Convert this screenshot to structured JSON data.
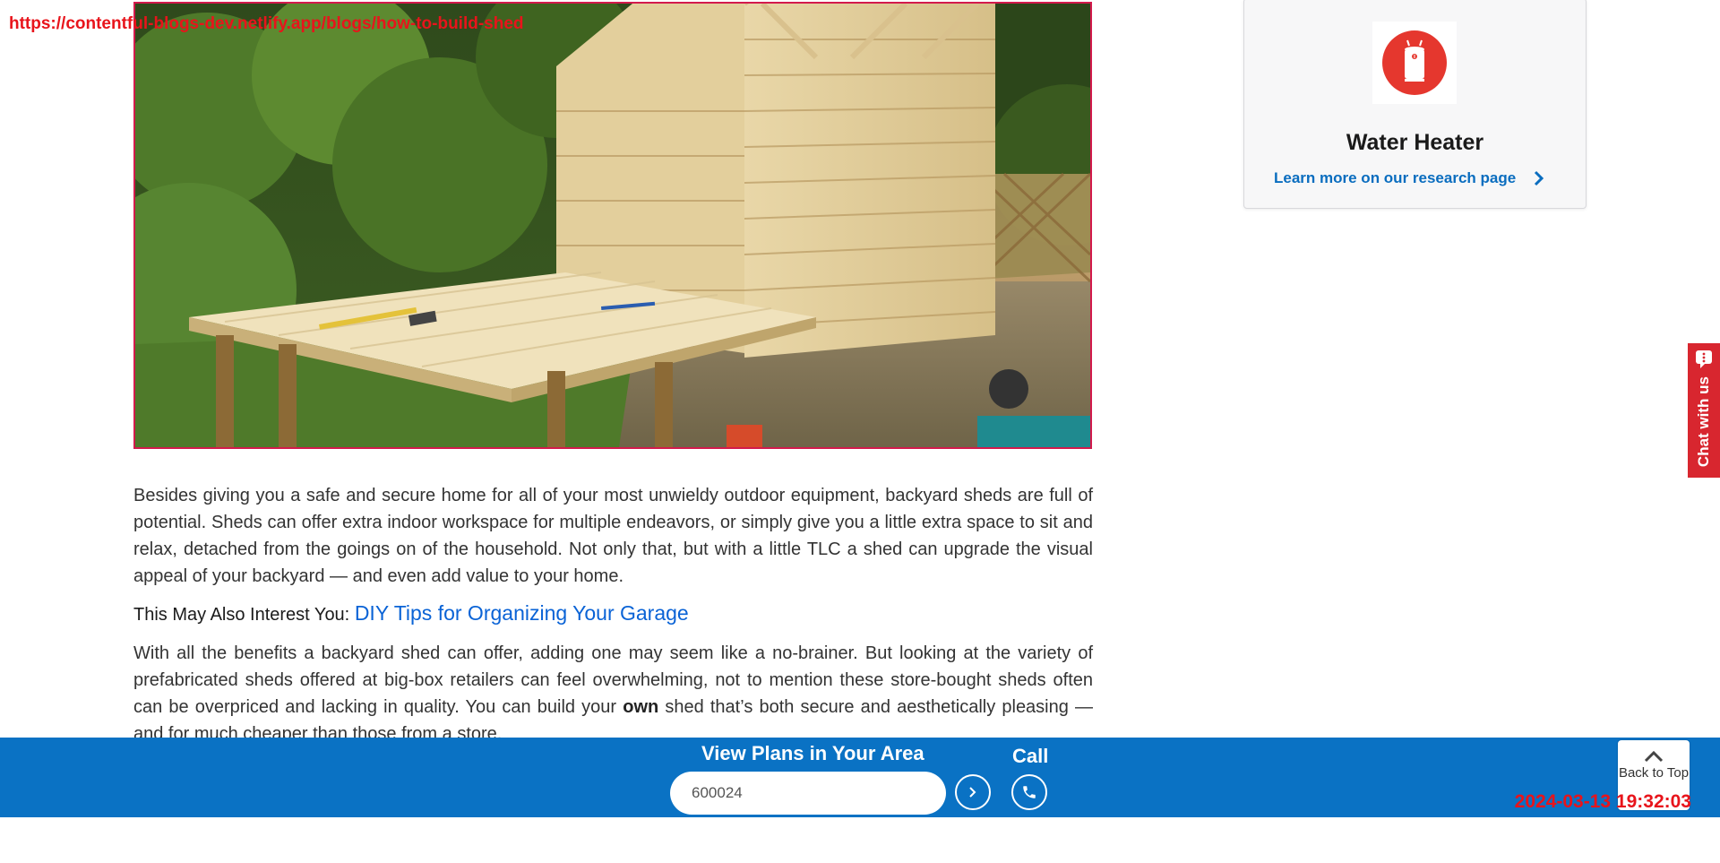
{
  "overlay": {
    "url": "https://contentful-blogs-dev.netlify.app/blogs/how-to-build-shed",
    "timestamp": "2024-03-13 19:32:03"
  },
  "article": {
    "paragraph1": "Besides giving you a safe and secure home for all of your most unwieldy outdoor equipment, backyard sheds are full of potential. Sheds can offer extra indoor workspace for multiple endeavors, or simply give you a little extra space to sit and relax, detached from the goings on of the household. Not only that, but with a little TLC a shed can upgrade the visual appeal of your backyard — and even add value to your home.",
    "interest_prefix": "This May Also Interest You:",
    "interest_link": "DIY Tips for Organizing Your Garage",
    "paragraph2_a": "With all the benefits a backyard shed can offer, adding one may seem like a no-brainer. But looking at the variety of prefabricated sheds offered at big-box retailers can feel overwhelming, not to mention these store-bought sheds often can be overpriced and lacking in quality. You can build your",
    "paragraph2_bold": "own",
    "paragraph2_b": "shed that’s both secure and aesthetically pleasing — and for much cheaper than those from a store."
  },
  "sidebar_card": {
    "title": "Water Heater",
    "link_label": "Learn more on our research page",
    "icon": "water-heater-icon",
    "icon_color": "#e5372e"
  },
  "chat": {
    "label": "Chat with us",
    "color": "#d8262f"
  },
  "bottom_bar": {
    "heading": "View Plans in Your Area",
    "zip_value": "600024",
    "call_label": "Call",
    "color": "#0a72c4"
  },
  "back_to_top": {
    "label": "Back to Top"
  }
}
